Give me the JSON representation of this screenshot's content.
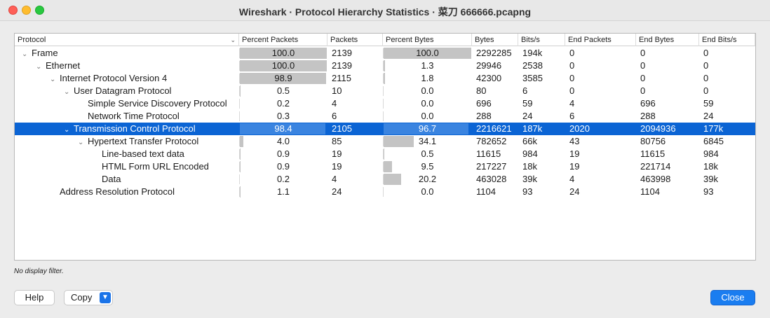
{
  "window": {
    "title": "Wireshark · Protocol Hierarchy Statistics · 菜刀 666666.pcapng"
  },
  "columns": [
    "Protocol",
    "Percent Packets",
    "Packets",
    "Percent Bytes",
    "Bytes",
    "Bits/s",
    "End Packets",
    "End Bytes",
    "End Bits/s"
  ],
  "rows": [
    {
      "protocol": "Frame",
      "depth": 0,
      "expanded": true,
      "pct_packets": "100.0",
      "packets": "2139",
      "pct_bytes": "100.0",
      "bytes": "2292285",
      "bits": "194k",
      "end_packets": "0",
      "end_bytes": "0",
      "end_bits": "0"
    },
    {
      "protocol": "Ethernet",
      "depth": 1,
      "expanded": true,
      "pct_packets": "100.0",
      "packets": "2139",
      "pct_bytes": "1.3",
      "bytes": "29946",
      "bits": "2538",
      "end_packets": "0",
      "end_bytes": "0",
      "end_bits": "0"
    },
    {
      "protocol": "Internet Protocol Version 4",
      "depth": 2,
      "expanded": true,
      "pct_packets": "98.9",
      "packets": "2115",
      "pct_bytes": "1.8",
      "bytes": "42300",
      "bits": "3585",
      "end_packets": "0",
      "end_bytes": "0",
      "end_bits": "0"
    },
    {
      "protocol": "User Datagram Protocol",
      "depth": 3,
      "expanded": true,
      "pct_packets": "0.5",
      "packets": "10",
      "pct_bytes": "0.0",
      "bytes": "80",
      "bits": "6",
      "end_packets": "0",
      "end_bytes": "0",
      "end_bits": "0"
    },
    {
      "protocol": "Simple Service Discovery Protocol",
      "depth": 4,
      "expanded": false,
      "pct_packets": "0.2",
      "packets": "4",
      "pct_bytes": "0.0",
      "bytes": "696",
      "bits": "59",
      "end_packets": "4",
      "end_bytes": "696",
      "end_bits": "59"
    },
    {
      "protocol": "Network Time Protocol",
      "depth": 4,
      "expanded": false,
      "pct_packets": "0.3",
      "packets": "6",
      "pct_bytes": "0.0",
      "bytes": "288",
      "bits": "24",
      "end_packets": "6",
      "end_bytes": "288",
      "end_bits": "24"
    },
    {
      "protocol": "Transmission Control Protocol",
      "depth": 3,
      "expanded": true,
      "selected": true,
      "pct_packets": "98.4",
      "packets": "2105",
      "pct_bytes": "96.7",
      "bytes": "2216621",
      "bits": "187k",
      "end_packets": "2020",
      "end_bytes": "2094936",
      "end_bits": "177k"
    },
    {
      "protocol": "Hypertext Transfer Protocol",
      "depth": 4,
      "expanded": true,
      "pct_packets": "4.0",
      "packets": "85",
      "pct_bytes": "34.1",
      "bytes": "782652",
      "bits": "66k",
      "end_packets": "43",
      "end_bytes": "80756",
      "end_bits": "6845"
    },
    {
      "protocol": "Line-based text data",
      "depth": 5,
      "expanded": false,
      "pct_packets": "0.9",
      "packets": "19",
      "pct_bytes": "0.5",
      "bytes": "11615",
      "bits": "984",
      "end_packets": "19",
      "end_bytes": "11615",
      "end_bits": "984"
    },
    {
      "protocol": "HTML Form URL Encoded",
      "depth": 5,
      "expanded": false,
      "pct_packets": "0.9",
      "packets": "19",
      "pct_bytes": "9.5",
      "bytes": "217227",
      "bits": "18k",
      "end_packets": "19",
      "end_bytes": "221714",
      "end_bits": "18k"
    },
    {
      "protocol": "Data",
      "depth": 5,
      "expanded": false,
      "pct_packets": "0.2",
      "packets": "4",
      "pct_bytes": "20.2",
      "bytes": "463028",
      "bits": "39k",
      "end_packets": "4",
      "end_bytes": "463998",
      "end_bits": "39k"
    },
    {
      "protocol": "Address Resolution Protocol",
      "depth": 2,
      "expanded": false,
      "pct_packets": "1.1",
      "packets": "24",
      "pct_bytes": "0.0",
      "bytes": "1104",
      "bits": "93",
      "end_packets": "24",
      "end_bytes": "1104",
      "end_bits": "93"
    }
  ],
  "status": {
    "filter_text": "No display filter."
  },
  "buttons": {
    "help": "Help",
    "copy": "Copy",
    "close": "Close"
  },
  "icons": {
    "sort_indicator": "chevron-down-icon",
    "expand": "chevron-down-icon",
    "copy_menu": "chevron-down-icon"
  },
  "colors": {
    "selection": "#0b64d4",
    "bar": "#c4c4c4",
    "close_button": "#1a7df0"
  }
}
